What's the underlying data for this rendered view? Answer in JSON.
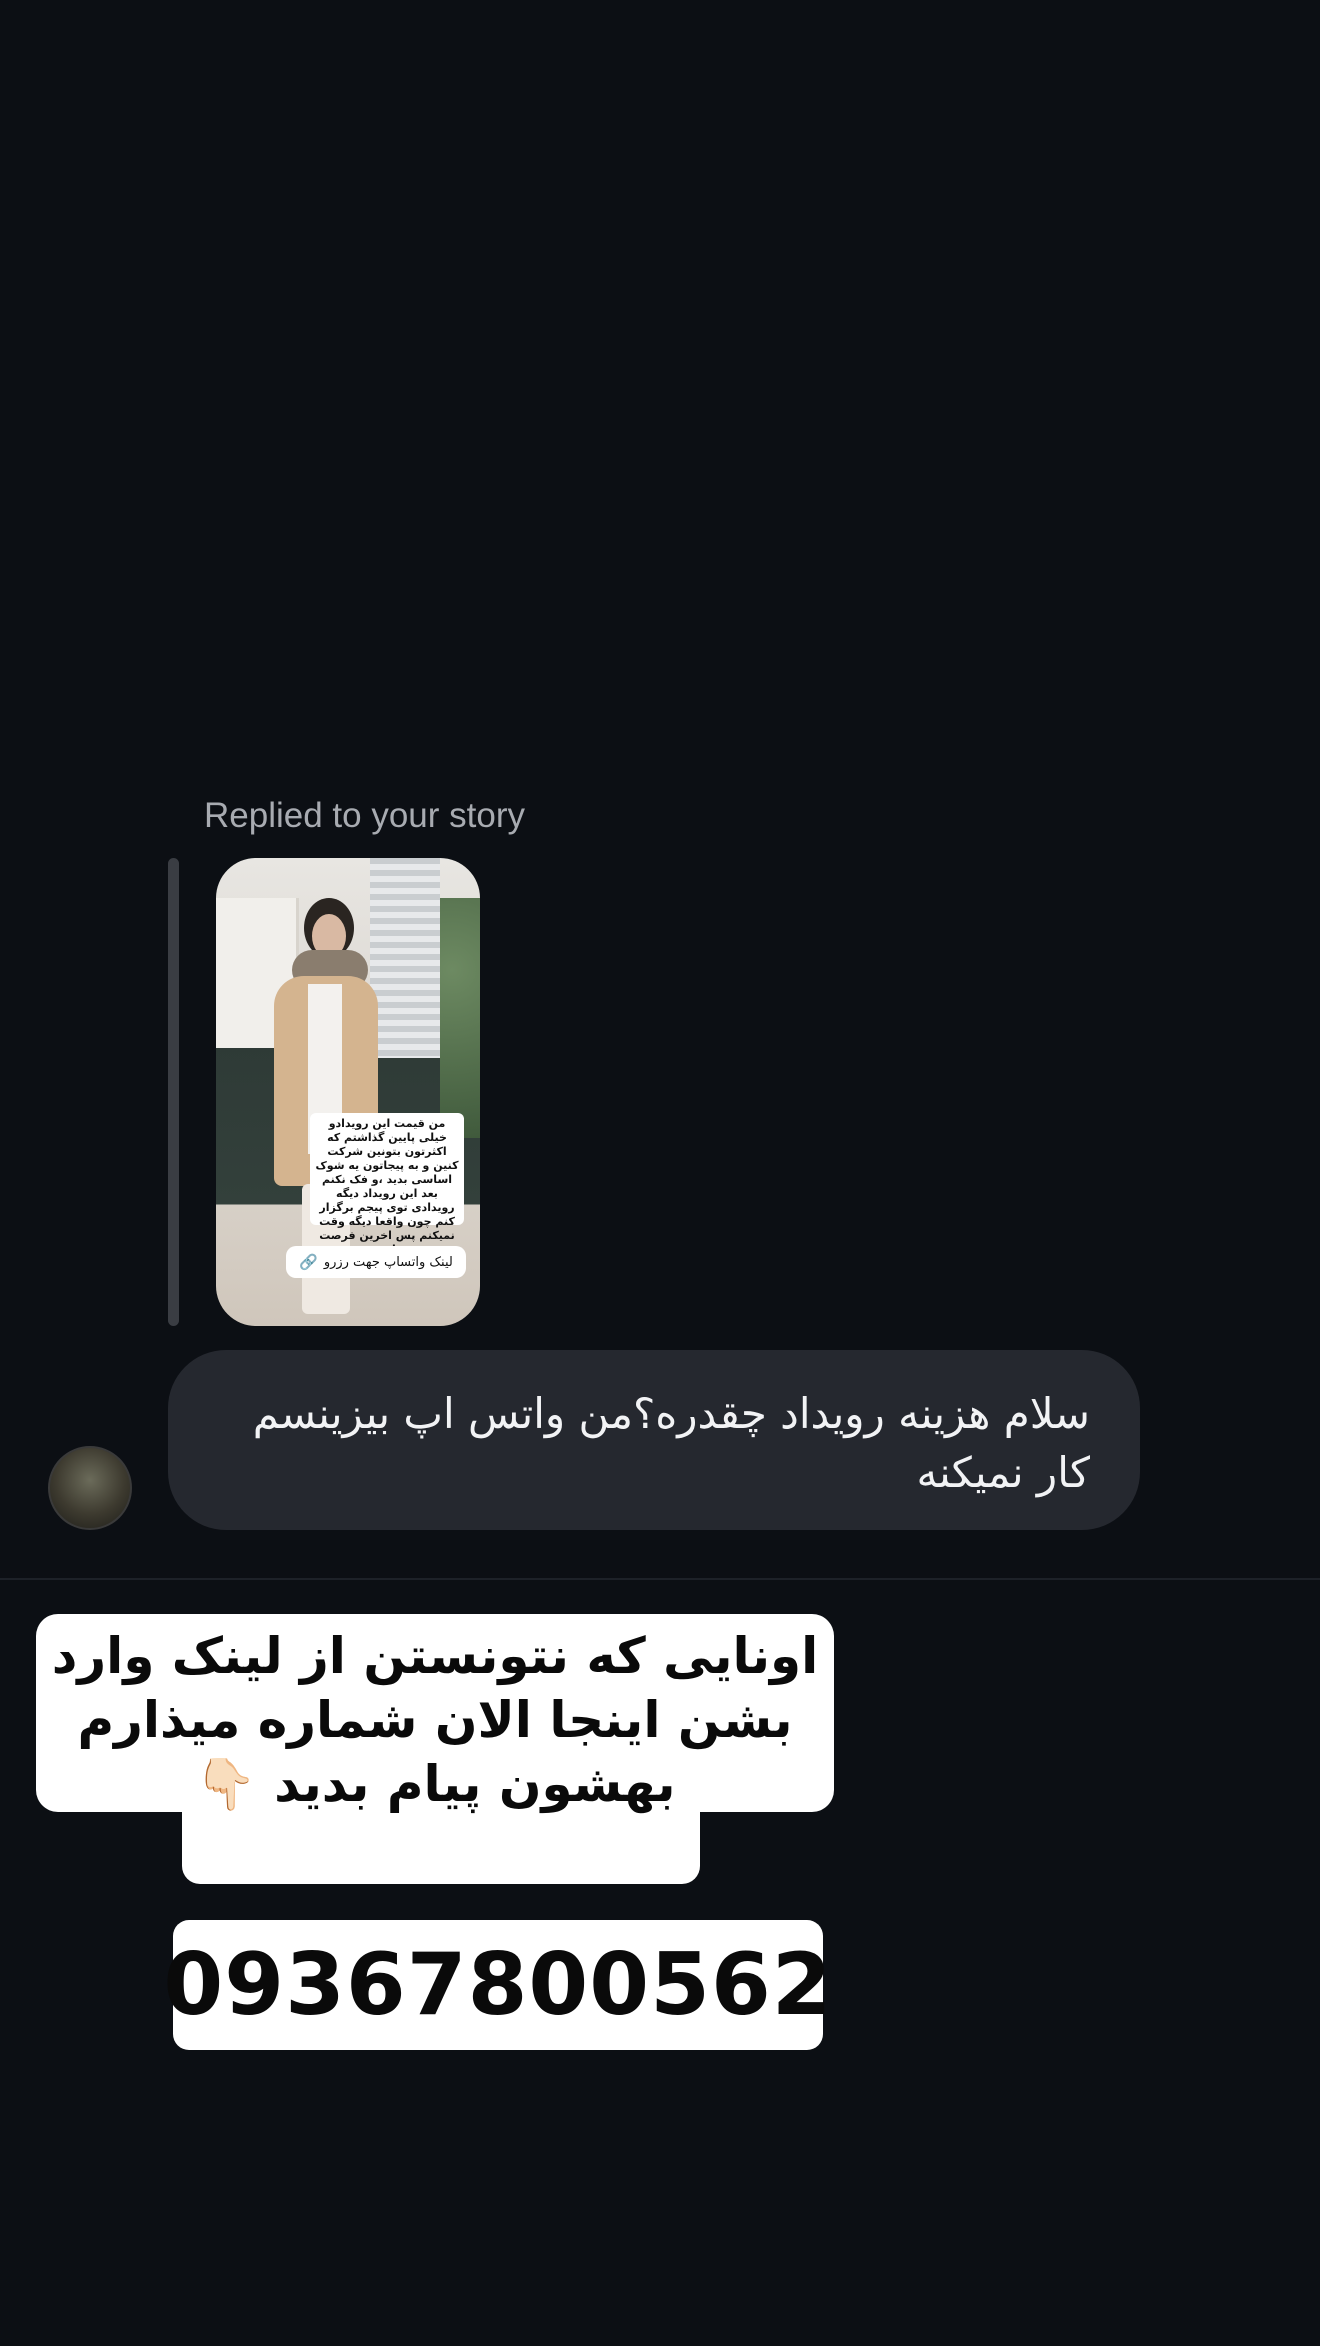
{
  "thread": {
    "reply_label": "Replied to your story",
    "story": {
      "caption": "من قیمت این رویدادو خیلی پایین گذاشتم که اکثرتون بتونین شرکت کنین و به پیجاتون یه شوک اساسی بدید ،و فک نکنم بعد این رویداد دیگه رویدادی توی پیجم برگزار کنم چون واقعا دیگه وقت نمیکنم پس اخرین فرصت هاتونه",
      "link_sticker": "لینک واتساپ جهت رزرو",
      "link_icon": "link-icon"
    },
    "message": {
      "text": "سلام هزینه رویداد چقدره؟من واتس اپ بیزینسم کار نمیکنه"
    }
  },
  "overlay": {
    "sticker_text": "اونایی که نتونستن از لینک وارد بشن اینجا الان شماره میذارم بهشون پیام بدید 👇🏻",
    "phone_number": "09367800562"
  },
  "colors": {
    "background": "#0c0f14",
    "bubble": "#25282f",
    "label": "#a8abb1"
  }
}
